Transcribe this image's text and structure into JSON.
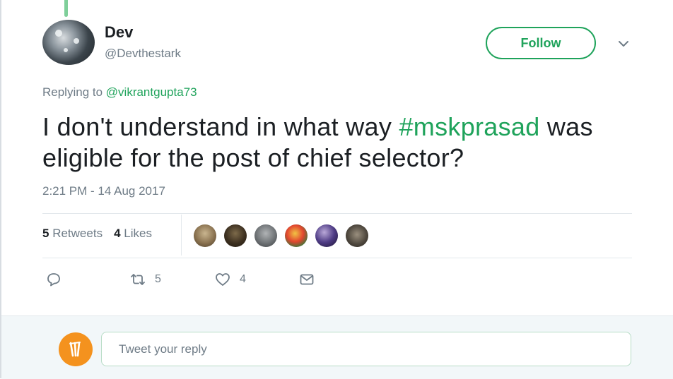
{
  "tweet": {
    "author_name": "Dev",
    "author_handle": "@Devthestark",
    "follow_label": "Follow",
    "replying_prefix": "Replying to ",
    "replying_mention": "@vikrantgupta73",
    "text_before": "I don't understand in what way ",
    "hashtag": "#mskprasad",
    "text_after": " was eligible for the post of chief selector?",
    "timestamp": "2:21 PM - 14 Aug 2017"
  },
  "stats": {
    "retweets_count": "5",
    "retweets_label": "Retweets",
    "likes_count": "4",
    "likes_label": "Likes",
    "liker_avatars": [
      "liker-avatar-1",
      "liker-avatar-2",
      "liker-avatar-3",
      "liker-avatar-4",
      "liker-avatar-5",
      "liker-avatar-6"
    ]
  },
  "actions": {
    "reply_icon": "reply-icon",
    "retweet_icon": "retweet-icon",
    "retweet_count": "5",
    "like_icon": "heart-icon",
    "like_count": "4",
    "dm_icon": "envelope-icon"
  },
  "reply_box": {
    "placeholder": "Tweet your reply"
  },
  "colors": {
    "accent": "#1fa35b",
    "muted_text": "#6e7b86",
    "reply_avatar_bg": "#f4921e",
    "reply_bar_bg": "#f2f7f9"
  }
}
